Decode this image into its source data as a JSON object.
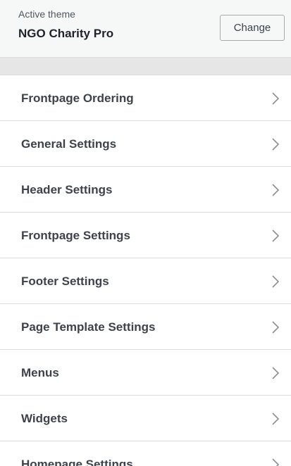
{
  "theme": {
    "caption": "Active theme",
    "name": "NGO Charity Pro",
    "change_label": "Change"
  },
  "sections": [
    {
      "label": "Frontpage Ordering",
      "icon": "chevron-right-icon"
    },
    {
      "label": "General Settings",
      "icon": "chevron-right-icon"
    },
    {
      "label": "Header Settings",
      "icon": "chevron-right-icon"
    },
    {
      "label": "Frontpage Settings",
      "icon": "chevron-right-icon"
    },
    {
      "label": "Footer Settings",
      "icon": "chevron-right-icon"
    },
    {
      "label": "Page Template Settings",
      "icon": "chevron-right-icon"
    },
    {
      "label": "Menus",
      "icon": "chevron-right-icon"
    },
    {
      "label": "Widgets",
      "icon": "chevron-right-icon"
    },
    {
      "label": "Homepage Settings",
      "icon": "chevron-right-icon"
    }
  ]
}
